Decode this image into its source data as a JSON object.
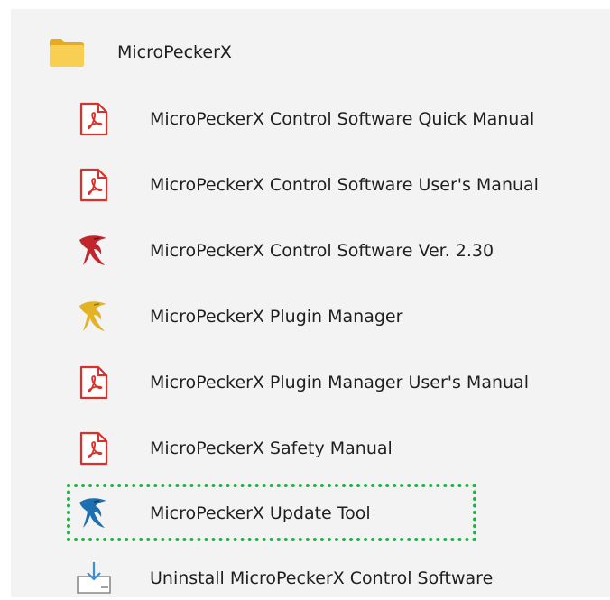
{
  "folder": {
    "label": "MicroPeckerX",
    "icon": "folder-icon"
  },
  "items": [
    {
      "label": "MicroPeckerX Control Software Quick Manual",
      "icon": "pdf-icon"
    },
    {
      "label": "MicroPeckerX Control Software User's Manual",
      "icon": "pdf-icon"
    },
    {
      "label": "MicroPeckerX Control Software Ver. 2.30",
      "icon": "bird-icon",
      "icon_color": "#c0262c"
    },
    {
      "label": "MicroPeckerX Plugin Manager",
      "icon": "bird-icon",
      "icon_color": "#e2b425"
    },
    {
      "label": "MicroPeckerX Plugin Manager User's Manual",
      "icon": "pdf-icon"
    },
    {
      "label": "MicroPeckerX Safety Manual",
      "icon": "pdf-icon"
    },
    {
      "label": "MicroPeckerX Update Tool",
      "icon": "bird-icon",
      "icon_color": "#1e6fb0",
      "highlighted": true
    },
    {
      "label": "Uninstall MicroPeckerX Control Software",
      "icon": "uninstall-icon"
    }
  ],
  "colors": {
    "highlight_border": "#1fb24a",
    "pdf_red": "#d9312b",
    "folder_yellow": "#f6c945"
  }
}
